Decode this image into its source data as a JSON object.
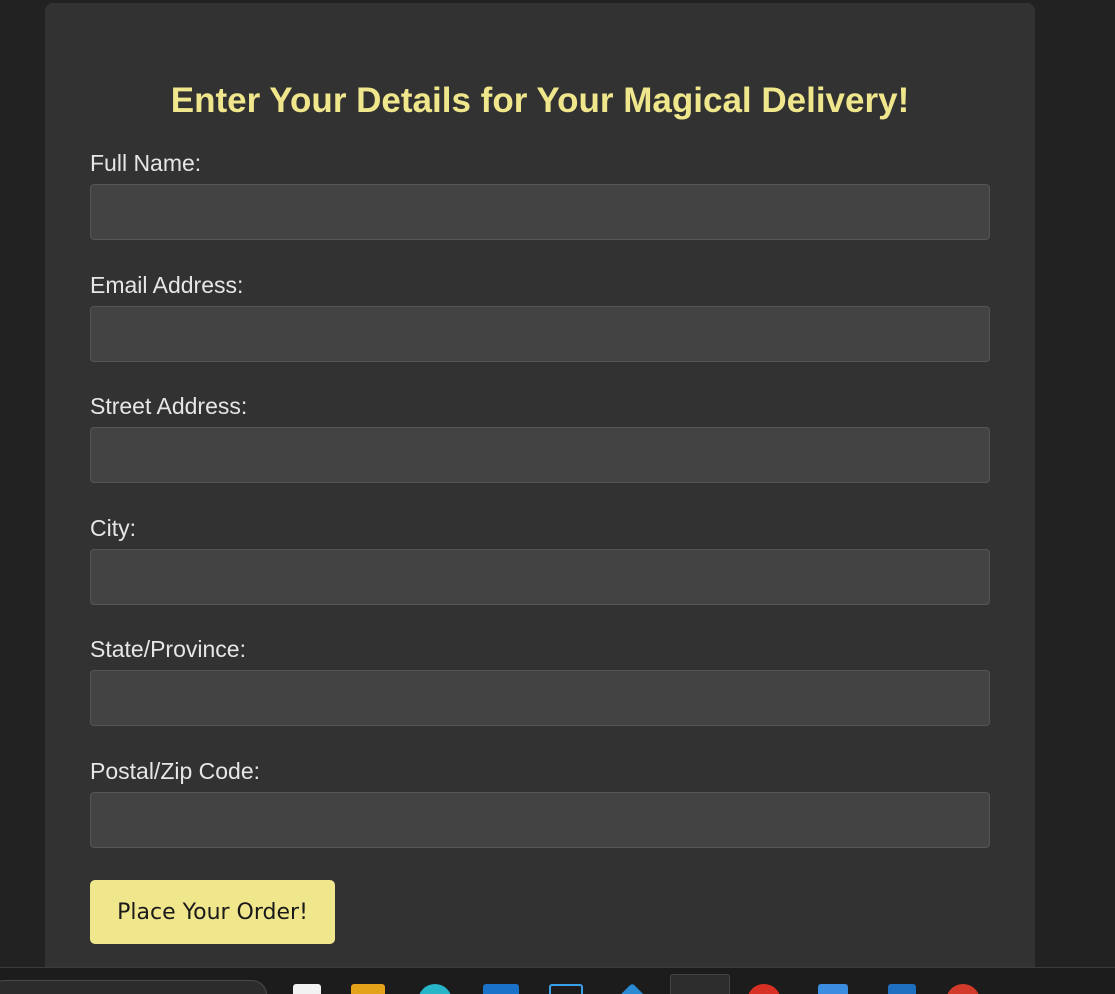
{
  "form": {
    "title": "Enter Your Details for Your Magical Delivery!",
    "fields": [
      {
        "label": "Full Name:",
        "value": "",
        "placeholder": ""
      },
      {
        "label": "Email Address:",
        "value": "",
        "placeholder": ""
      },
      {
        "label": "Street Address:",
        "value": "",
        "placeholder": ""
      },
      {
        "label": "City:",
        "value": "",
        "placeholder": ""
      },
      {
        "label": "State/Province:",
        "value": "",
        "placeholder": ""
      },
      {
        "label": "Postal/Zip Code:",
        "value": "",
        "placeholder": ""
      }
    ],
    "submit_label": "Place Your Order!"
  },
  "colors": {
    "page_background": "#222222",
    "card_background": "#323232",
    "accent": "#f0e68c",
    "input_background": "#434343"
  },
  "taskbar": {
    "apps": [
      {
        "name": "search-box-icon"
      },
      {
        "name": "notepad-icon",
        "color": "#f2f2f2"
      },
      {
        "name": "file-explorer-icon",
        "color": "#e3a21a"
      },
      {
        "name": "edge-browser-icon",
        "color": "#27b5c8"
      },
      {
        "name": "outlook-icon",
        "color": "#1a73c9"
      },
      {
        "name": "snipping-tool-icon",
        "color": "#3aa0e8"
      },
      {
        "name": "vscode-icon",
        "color": "#2a8ad4"
      },
      {
        "name": "active-app-icon",
        "color": "#f0c020"
      },
      {
        "name": "chrome-icon",
        "color": "#d93025"
      },
      {
        "name": "photos-icon",
        "color": "#3a8de0"
      },
      {
        "name": "terminal-icon",
        "color": "#1e6fc0"
      },
      {
        "name": "paint-icon",
        "color": "#d23a2a"
      }
    ]
  }
}
